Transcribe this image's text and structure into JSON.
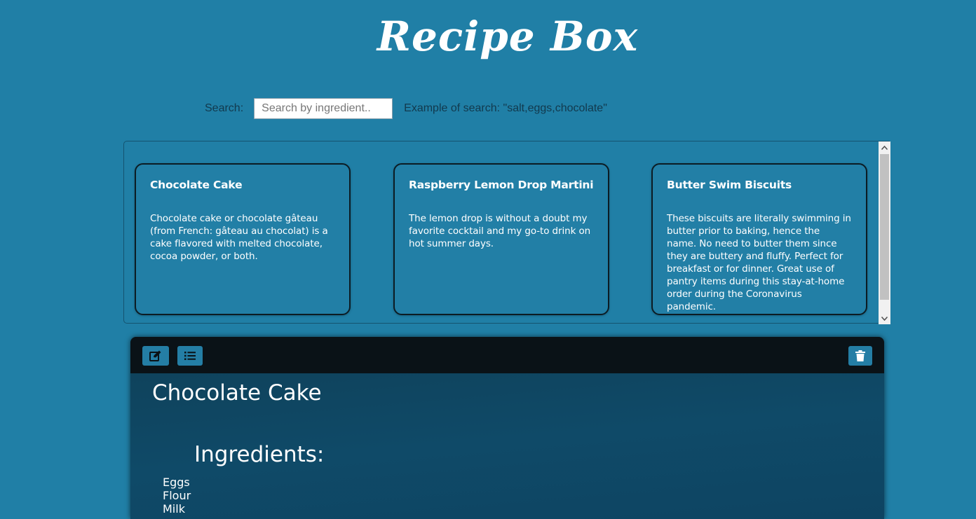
{
  "app": {
    "title": "Recipe Box"
  },
  "search": {
    "label": "Search:",
    "placeholder": "Search by ingredient..",
    "example": "Example of search: \"salt,eggs,chocolate\""
  },
  "recipes": [
    {
      "title": "Chocolate Cake",
      "description": "Chocolate cake or chocolate gâteau (from French: gâteau au chocolat) is a cake flavored with melted chocolate, cocoa powder, or both."
    },
    {
      "title": "Raspberry Lemon Drop Martini",
      "description": "The lemon drop is without a doubt my favorite cocktail and my go-to drink on hot summer days."
    },
    {
      "title": "Butter Swim Biscuits",
      "description": "These biscuits are literally swimming in butter prior to baking, hence the name. No need to butter them since they are buttery and fluffy. Perfect for breakfast or for dinner. Great use of pantry items during this stay-at-home order during the Coronavirus pandemic."
    }
  ],
  "detail": {
    "title": "Chocolate Cake",
    "ingredients_heading": "Ingredients:",
    "ingredients": [
      "Eggs",
      "Flour",
      "Milk"
    ],
    "toolbar_icons": {
      "edit": "edit-icon",
      "list": "list-icon",
      "delete": "trash-icon"
    }
  },
  "colors": {
    "background": "#207fa6",
    "card_border": "#0c1c24",
    "toolbar": "#0a1217",
    "button": "#247ea5"
  }
}
